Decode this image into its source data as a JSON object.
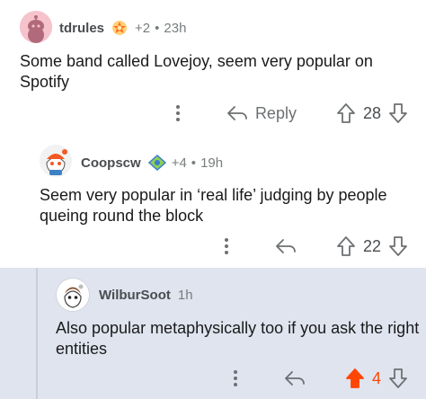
{
  "comments": [
    {
      "username": "tdrules",
      "award_count": "+2",
      "time": "23h",
      "body": "Some band called Lovejoy, seem very popular on Spotify",
      "reply_label": "Reply",
      "score": "28",
      "avatar_icon": "snoo-avatar-icon",
      "flair_icon": "award-icon"
    },
    {
      "username": "Coopscw",
      "award_count": "+4",
      "time": "19h",
      "body": "Seem very popular in ‘real life’ judging by people queing round the block",
      "score": "22",
      "avatar_icon": "snoo-avatar-icon",
      "flair_icon": "award-icon"
    },
    {
      "username": "WilburSoot",
      "time": "1h",
      "body": "Also popular metaphysically too if you ask the right entities",
      "score": "4",
      "avatar_icon": "snoo-avatar-icon",
      "upvoted": true
    }
  ],
  "colors": {
    "upvote_active": "#ff4500",
    "highlight_bg": "#dfe4ef",
    "meta_text": "#787c7e"
  }
}
